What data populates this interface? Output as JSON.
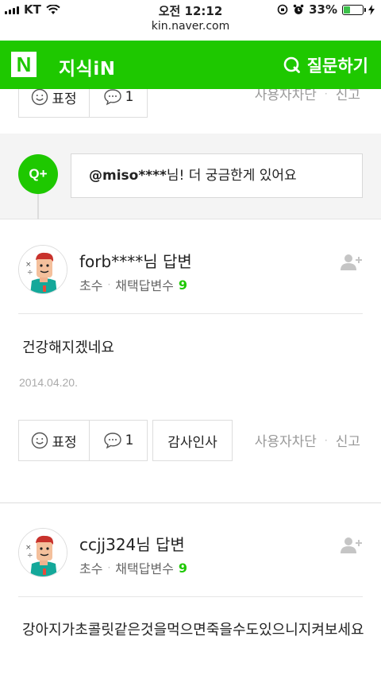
{
  "status_bar": {
    "carrier": "KT",
    "time": "오전 12:12",
    "battery_percent": "33%",
    "battery_level": 0.33,
    "url": "kin.naver.com"
  },
  "header": {
    "logo": "N",
    "title": "지식iN",
    "ask_label": "질문하기"
  },
  "top_actions": {
    "reaction_label": "표정",
    "comment_count": "1",
    "block_label": "사용자차단",
    "report_label": "신고"
  },
  "qplus": {
    "icon_label": "Q+",
    "mention": "@miso****",
    "message": "님! 더 궁금한게 있어요"
  },
  "answers": [
    {
      "author": "forb****님 답변",
      "rank": "초수",
      "selected_label": "채택답변수",
      "selected_count": "9",
      "body": "건강해지겠네요",
      "date": "2014.04.20.",
      "reaction_label": "표정",
      "comment_count": "1",
      "thanks_label": "감사인사",
      "block_label": "사용자차단",
      "report_label": "신고"
    },
    {
      "author": "ccjj324님 답변",
      "rank": "초수",
      "selected_label": "채택답변수",
      "selected_count": "9",
      "body": "강아지가초콜릿같은것을먹으면죽을수도있으니지켜보세요"
    }
  ],
  "colors": {
    "brand_green": "#1ec800",
    "battery_green": "#3cc14a"
  }
}
